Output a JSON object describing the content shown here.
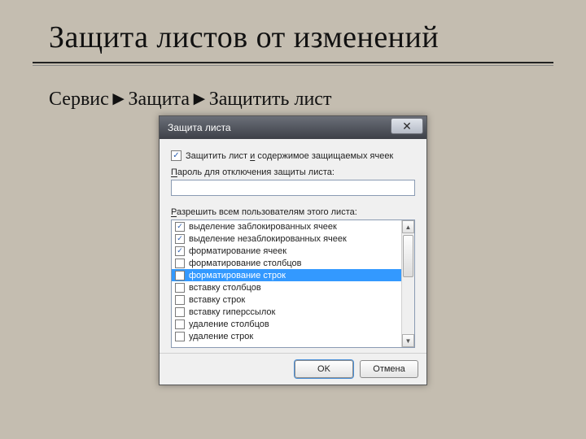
{
  "slide": {
    "title": "Защита листов от изменений",
    "subtitle": "Сервис►Защита►Защитить лист"
  },
  "dialog": {
    "title": "Защита листа",
    "protect_checkbox": {
      "checked": true,
      "label_before": "Защитить лист ",
      "label_underlined": "и",
      "label_after": " содержимое защищаемых ячеек"
    },
    "password_label": {
      "u": "П",
      "rest": "ароль для отключения защиты листа:"
    },
    "password_value": "",
    "permissions_label": {
      "u": "Р",
      "rest": "азрешить всем пользователям этого листа:"
    },
    "permissions": [
      {
        "label": "выделение заблокированных ячеек",
        "checked": true,
        "selected": false
      },
      {
        "label": "выделение незаблокированных ячеек",
        "checked": true,
        "selected": false
      },
      {
        "label": "форматирование ячеек",
        "checked": true,
        "selected": false
      },
      {
        "label": "форматирование столбцов",
        "checked": false,
        "selected": false
      },
      {
        "label": "форматирование строк",
        "checked": false,
        "selected": true
      },
      {
        "label": "вставку столбцов",
        "checked": false,
        "selected": false
      },
      {
        "label": "вставку строк",
        "checked": false,
        "selected": false
      },
      {
        "label": "вставку гиперссылок",
        "checked": false,
        "selected": false
      },
      {
        "label": "удаление столбцов",
        "checked": false,
        "selected": false
      },
      {
        "label": "удаление строк",
        "checked": false,
        "selected": false
      }
    ],
    "buttons": {
      "ok": "OK",
      "cancel": "Отмена"
    }
  }
}
